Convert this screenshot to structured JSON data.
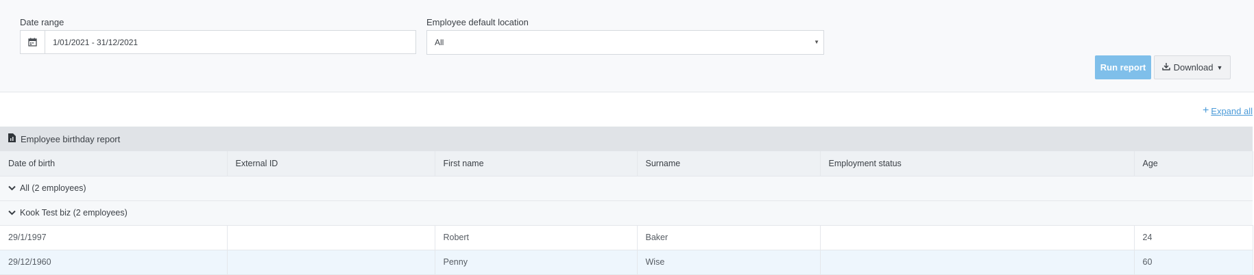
{
  "filters": {
    "date_range_label": "Date range",
    "date_range_value": "1/01/2021 - 31/12/2021",
    "location_label": "Employee default location",
    "location_value": "All"
  },
  "actions": {
    "run_report": "Run report",
    "download": "Download",
    "expand_all": "Expand all"
  },
  "report": {
    "title": "Employee birthday report",
    "columns": [
      "Date of birth",
      "External ID",
      "First name",
      "Surname",
      "Employment status",
      "Age"
    ],
    "groups": [
      "All (2 employees)",
      "Kook Test biz (2 employees)"
    ],
    "rows": [
      {
        "dob": "29/1/1997",
        "external_id": "",
        "first_name": "Robert",
        "surname": "Baker",
        "status": "",
        "age": "24"
      },
      {
        "dob": "29/12/1960",
        "external_id": "",
        "first_name": "Penny",
        "surname": "Wise",
        "status": "",
        "age": "60"
      }
    ]
  },
  "colors": {
    "accent": "#7fbfea",
    "link": "#4a9ad8",
    "header_bg": "#e0e3e7",
    "row_highlight": "#eef6fd"
  }
}
